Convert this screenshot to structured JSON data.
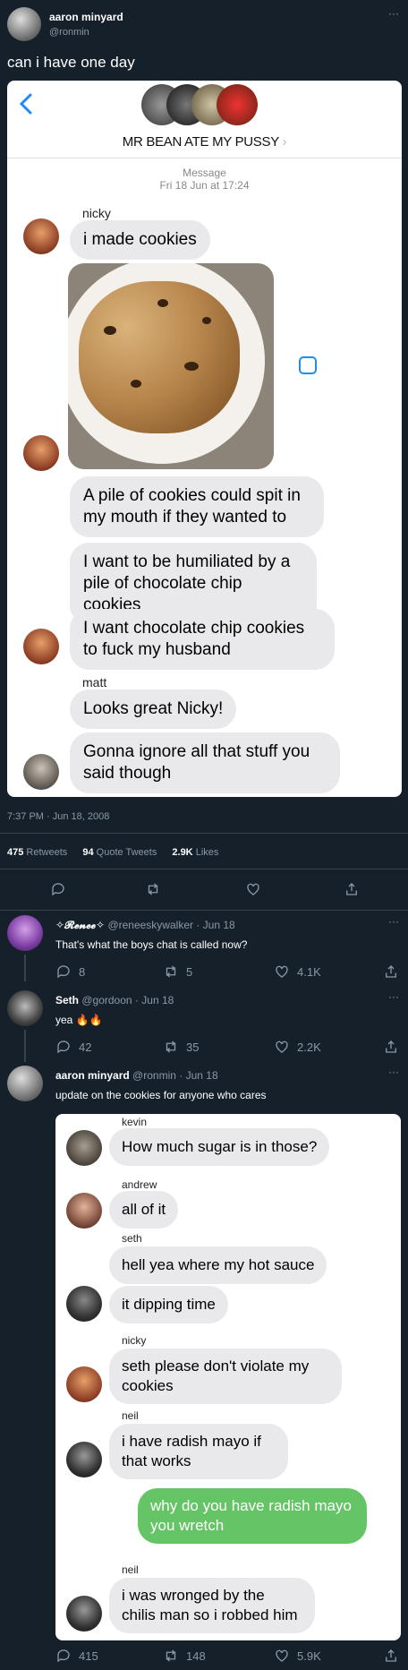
{
  "tweet": {
    "author_name": "aaron minyard",
    "author_handle": "@ronmin",
    "text": "can i have one day",
    "timestamp": "7:37 PM · Jun 18, 2008",
    "retweets_count": "475",
    "retweets_label": "Retweets",
    "quotes_count": "94",
    "quotes_label": "Quote Tweets",
    "likes_count": "2.9K",
    "likes_label": "Likes",
    "more": "···"
  },
  "screenshot1": {
    "group_name": "MR BEAN ATE MY PUSSY",
    "message_label": "Message",
    "date": "Fri 18 Jun at 17:24",
    "sender1": "nicky",
    "msg1": "i made cookies",
    "msg2": "A pile of cookies could spit in my mouth if they wanted to",
    "msg3": "I want to be humiliated by a pile of chocolate chip cookies",
    "msg4": "I want chocolate chip cookies to fuck my husband",
    "sender2": "matt",
    "msg5": "Looks great Nicky!",
    "msg6": "Gonna ignore all that stuff you said though"
  },
  "replies": [
    {
      "name": "✧𝓡𝓮𝓷𝓮𝓮✧",
      "handle": "@reneeskywalker",
      "date": "· Jun 18",
      "text": "That's what the boys chat is called now?",
      "replies": "8",
      "retweets": "5",
      "likes": "4.1K"
    },
    {
      "name": "Seth",
      "handle": "@gordoon",
      "date": "· Jun 18",
      "text": "yea 🔥🔥",
      "replies": "42",
      "retweets": "35",
      "likes": "2.2K"
    },
    {
      "name": "aaron minyard",
      "handle": "@ronmin",
      "date": "· Jun 18",
      "text": "update on the cookies for anyone who cares",
      "replies": "415",
      "retweets": "148",
      "likes": "5.9K"
    }
  ],
  "screenshot2": {
    "s_kevin": "kevin",
    "m_kevin": "How much sugar is in those?",
    "s_andrew": "andrew",
    "m_andrew": "all of it",
    "s_seth": "seth",
    "m_seth1": "hell yea where my hot sauce",
    "m_seth2": "it dipping time",
    "s_nicky": "nicky",
    "m_nicky": "seth please don't violate my cookies",
    "s_neil": "neil",
    "m_neil1": "i have radish mayo if that works",
    "m_me": "why do you have radish mayo you wretch",
    "s_neil2": "neil",
    "m_neil2": "i was wronged by the chilis man so i robbed him"
  },
  "colors": {
    "background": "#15202b",
    "muted": "#8b98a5",
    "imessage_green": "#65c466",
    "ios_blue": "#1d8cf8"
  }
}
